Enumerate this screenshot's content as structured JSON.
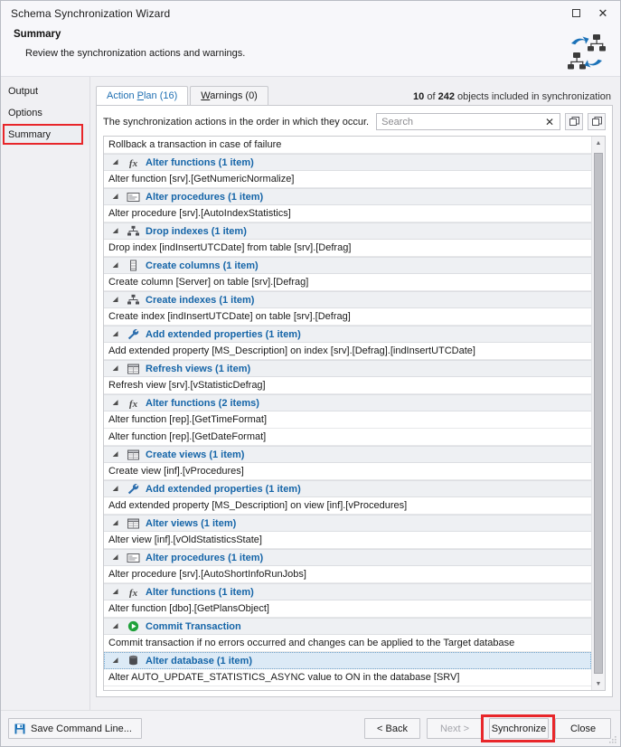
{
  "window": {
    "title": "Schema Synchronization Wizard",
    "maximize_label": "maximize",
    "close_label": "close"
  },
  "header": {
    "heading": "Summary",
    "subheading": "Review the synchronization actions and warnings.",
    "logo_name": "schema-sync-logo"
  },
  "sidebar": {
    "items": [
      {
        "label": "Output",
        "selected": false
      },
      {
        "label": "Options",
        "selected": false
      },
      {
        "label": "Summary",
        "selected": true
      }
    ]
  },
  "tabs": [
    {
      "label": "Action Plan (16)",
      "active": true
    },
    {
      "label": "Warnings (0)",
      "active": false
    }
  ],
  "object_count": {
    "included": "10",
    "separator": " of ",
    "total": "242",
    "suffix": " objects included in synchronization"
  },
  "search": {
    "label": "The synchronization actions in the order in which they occur.",
    "value": "",
    "placeholder": "Search",
    "clear_label": "✕",
    "expand_all_label": "expand-all",
    "collapse_all_label": "collapse-all"
  },
  "action_plan": [
    {
      "kind": "detail",
      "text": "Rollback a transaction in case of failure"
    },
    {
      "kind": "group",
      "icon": "function",
      "text": "Alter functions (1 item)"
    },
    {
      "kind": "detail",
      "text": "Alter function [srv].[GetNumericNormalize]"
    },
    {
      "kind": "group",
      "icon": "procedure",
      "text": "Alter procedures (1 item)"
    },
    {
      "kind": "detail",
      "text": "Alter procedure [srv].[AutoIndexStatistics]"
    },
    {
      "kind": "group",
      "icon": "index",
      "text": "Drop indexes (1 item)"
    },
    {
      "kind": "detail",
      "text": "Drop index [indInsertUTCDate] from table [srv].[Defrag]"
    },
    {
      "kind": "group",
      "icon": "column",
      "text": "Create columns (1 item)"
    },
    {
      "kind": "detail",
      "text": "Create column [Server] on table [srv].[Defrag]"
    },
    {
      "kind": "group",
      "icon": "index",
      "text": "Create indexes (1 item)"
    },
    {
      "kind": "detail",
      "text": "Create index [indInsertUTCDate] on table [srv].[Defrag]"
    },
    {
      "kind": "group",
      "icon": "wrench",
      "text": "Add extended properties (1 item)"
    },
    {
      "kind": "detail",
      "text": "Add extended property [MS_Description] on index [srv].[Defrag].[indInsertUTCDate]"
    },
    {
      "kind": "group",
      "icon": "view",
      "text": "Refresh views (1 item)"
    },
    {
      "kind": "detail",
      "text": "Refresh view [srv].[vStatisticDefrag]"
    },
    {
      "kind": "group",
      "icon": "function",
      "text": "Alter functions (2 items)"
    },
    {
      "kind": "detail",
      "text": "Alter function [rep].[GetTimeFormat]"
    },
    {
      "kind": "detail",
      "text": "Alter function [rep].[GetDateFormat]"
    },
    {
      "kind": "group",
      "icon": "view",
      "text": "Create views (1 item)"
    },
    {
      "kind": "detail",
      "text": "Create view [inf].[vProcedures]"
    },
    {
      "kind": "group",
      "icon": "wrench",
      "text": "Add extended properties (1 item)"
    },
    {
      "kind": "detail",
      "text": "Add extended property [MS_Description] on view [inf].[vProcedures]"
    },
    {
      "kind": "group",
      "icon": "view",
      "text": "Alter views (1 item)"
    },
    {
      "kind": "detail",
      "text": "Alter view [inf].[vOldStatisticsState]"
    },
    {
      "kind": "group",
      "icon": "procedure",
      "text": "Alter procedures (1 item)"
    },
    {
      "kind": "detail",
      "text": "Alter procedure [srv].[AutoShortInfoRunJobs]"
    },
    {
      "kind": "group",
      "icon": "function",
      "text": "Alter functions (1 item)"
    },
    {
      "kind": "detail",
      "text": "Alter function [dbo].[GetPlansObject]"
    },
    {
      "kind": "group",
      "icon": "commit",
      "text": "Commit Transaction"
    },
    {
      "kind": "detail",
      "text": "Commit transaction if no errors occurred and changes can be applied to the Target database"
    },
    {
      "kind": "group",
      "icon": "database",
      "text": "Alter database (1 item)",
      "selected": true
    },
    {
      "kind": "detail",
      "text": "Alter AUTO_UPDATE_STATISTICS_ASYNC value to ON in the database [SRV]"
    }
  ],
  "footer": {
    "save_command_line": "Save Command Line...",
    "back": "< Back",
    "next": "Next >",
    "synchronize": "Synchronize",
    "close": "Close"
  },
  "colors": {
    "accent_blue": "#1565a8",
    "highlight_red": "#e8262a",
    "tab_active_blue": "#1f6fb2",
    "selection_blue": "#dceaf6"
  }
}
